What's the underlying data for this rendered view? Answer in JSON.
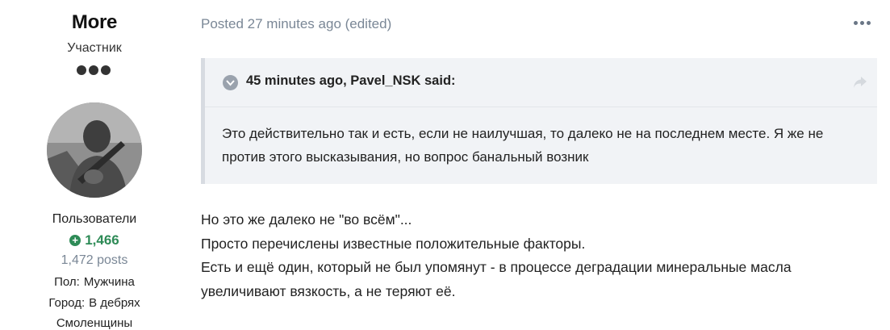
{
  "author": {
    "name": "More",
    "role": "Участник",
    "group": "Пользователи",
    "reputation": "1,466",
    "posts": "1,472 posts",
    "fields": [
      {
        "label": "Пол:",
        "value": "Мужчина"
      },
      {
        "label": "Город:",
        "value": "В дебрях"
      },
      {
        "label": "",
        "value": "Смоленщины"
      }
    ]
  },
  "post": {
    "meta": "Posted 27 minutes ago (edited)",
    "quote": {
      "citation": "45 minutes ago, Pavel_NSK said:",
      "text": "Это действительно так и есть, если не наилучшая, то далеко не на последнем месте. Я же не против этого высказывания, но вопрос банальный возник"
    },
    "lines": [
      "Но это же далеко не \"во всём\"...",
      "Просто перечислены известные положительные факторы.",
      "Есть и ещё один, который не был упомянут - в процессе деградации минеральные масла увеличивают вязкость, а не теряют её."
    ]
  },
  "icons": {
    "rank": "rank-dots-icon",
    "reputation": "plus-circle-icon",
    "menu": "ellipsis-icon",
    "quote_toggle": "chevron-circle-icon",
    "quote_share": "share-arrow-icon"
  },
  "colors": {
    "reputation": "#2e8b57",
    "meta": "#7a8796",
    "quote_bg": "#f1f3f6"
  }
}
